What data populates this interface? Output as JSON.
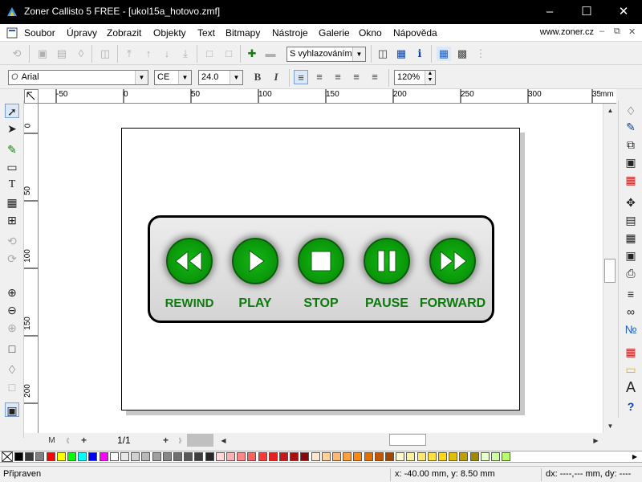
{
  "window": {
    "title": "Zoner Callisto 5 FREE - [ukol15a_hotovo.zmf]"
  },
  "menu": {
    "items": [
      "Soubor",
      "Úpravy",
      "Zobrazit",
      "Objekty",
      "Text",
      "Bitmapy",
      "Nástroje",
      "Galerie",
      "Okno",
      "Nápověda"
    ],
    "site": "www.zoner.cz"
  },
  "toolbar": {
    "smoothing_select": "S vyhlazováním",
    "font_select": "Arial",
    "encoding_select": "CE",
    "size_select": "24.0",
    "zoom_value": "120%",
    "bold_label": "B",
    "italic_label": "I"
  },
  "ruler": {
    "h_ticks": [
      "-50",
      "0",
      "50",
      "100",
      "150",
      "200",
      "250",
      "300",
      "350"
    ],
    "h_unit": "mm",
    "v_ticks": [
      "0",
      "50",
      "100",
      "150",
      "200"
    ]
  },
  "panel": {
    "buttons": [
      {
        "label": "REWIND",
        "icon": "rewind-icon"
      },
      {
        "label": "PLAY",
        "icon": "play-icon"
      },
      {
        "label": "STOP",
        "icon": "stop-icon"
      },
      {
        "label": "PAUSE",
        "icon": "pause-icon"
      },
      {
        "label": "FORWARD",
        "icon": "forward-icon"
      }
    ],
    "colors": {
      "button": "#0b9a0b",
      "label": "#0e7a0e",
      "panel": "#dcdcdc"
    }
  },
  "pages": {
    "indicator": "1/1"
  },
  "status": {
    "state": "Připraven",
    "coords": "x: -40.00 mm, y:  8.50 mm",
    "delta": "dx: ----,--- mm, dy: ----"
  },
  "palette": [
    "#000000",
    "#3a3a3a",
    "#808080",
    "#ff0000",
    "#ffff00",
    "#00ff00",
    "#00ffff",
    "#0000ff",
    "#ff00ff",
    "#ffffff",
    "#e8e8e8",
    "#d0d0d0",
    "#b8b8b8",
    "#a0a0a0",
    "#888888",
    "#707070",
    "#585858",
    "#404040",
    "#282828",
    "#ffd8d8",
    "#ffb0b0",
    "#ff8888",
    "#ff6060",
    "#ff3838",
    "#e82020",
    "#c81818",
    "#a81010",
    "#880808",
    "#ffe8d0",
    "#ffd0a0",
    "#ffb870",
    "#ffa040",
    "#ff8810",
    "#e07000",
    "#c05800",
    "#a04800",
    "#fff8d0",
    "#fff0a0",
    "#ffe870",
    "#ffe040",
    "#ffd810",
    "#e0c000",
    "#c0a000",
    "#a08800",
    "#e8ffd0",
    "#d0ffa0",
    "#b8ff70"
  ]
}
